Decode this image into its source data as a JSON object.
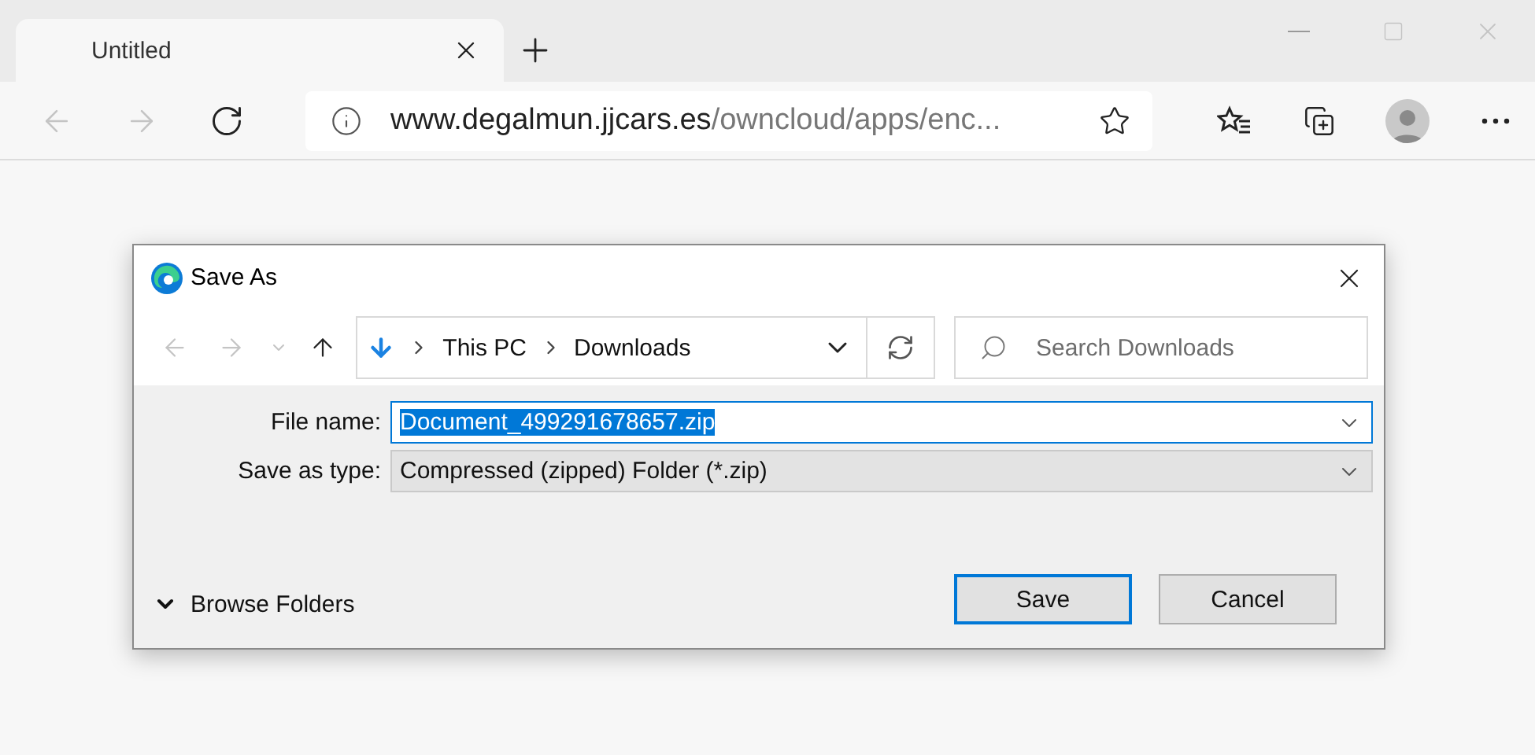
{
  "browser": {
    "tabs": [
      {
        "title": "Untitled",
        "selected": true
      }
    ],
    "nav": {
      "back_disabled": true,
      "forward_disabled": true
    },
    "address": {
      "host": "www.degalmun.jjcars.es",
      "path": "/owncloud/apps/enc..."
    }
  },
  "dialog": {
    "title": "Save As",
    "nav": {
      "back_disabled": true,
      "forward_disabled": true
    },
    "breadcrumb": [
      "This PC",
      "Downloads"
    ],
    "search": {
      "placeholder": "Search Downloads"
    },
    "fields": [
      {
        "label": "File name:",
        "value": "Document_499291678657.zip",
        "kind": "input",
        "text_selected": true
      },
      {
        "label": "Save as type:",
        "value": "Compressed (zipped) Folder (*.zip)",
        "kind": "select",
        "text_selected": false
      }
    ],
    "browse_folders": "Browse Folders",
    "buttons": [
      {
        "label": "Save",
        "default": true
      },
      {
        "label": "Cancel",
        "default": false
      }
    ]
  }
}
